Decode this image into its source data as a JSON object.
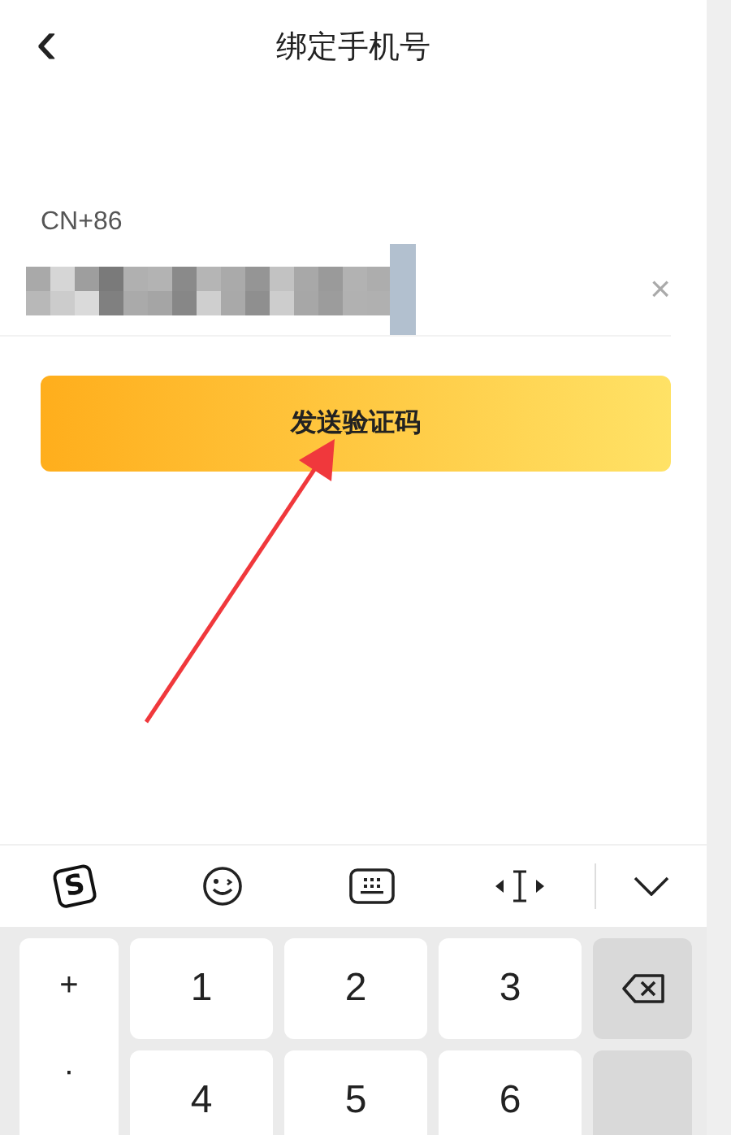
{
  "header": {
    "back": "‹",
    "title": "绑定手机号"
  },
  "phone": {
    "country_code": "CN+86",
    "clear": "×"
  },
  "send_button": {
    "label": "发送验证码"
  },
  "keyboard": {
    "toolbar": [
      {
        "kind": "logo",
        "text": "S"
      },
      {
        "kind": "emoji"
      },
      {
        "kind": "keyboard"
      },
      {
        "kind": "cursor"
      },
      {
        "kind": "collapse"
      }
    ],
    "side_keys": [
      "+",
      "·"
    ],
    "keys": [
      {
        "kind": "digit",
        "text": "1"
      },
      {
        "kind": "digit",
        "text": "2"
      },
      {
        "kind": "digit",
        "text": "3"
      },
      {
        "kind": "backspace"
      },
      {
        "kind": "digit",
        "text": "4"
      },
      {
        "kind": "digit",
        "text": "5"
      },
      {
        "kind": "digit",
        "text": "6"
      },
      {
        "kind": "function"
      }
    ]
  }
}
